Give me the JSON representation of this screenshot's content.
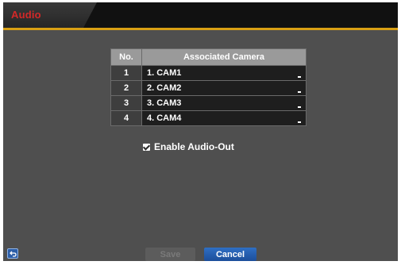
{
  "window": {
    "title": "Audio"
  },
  "table": {
    "headers": {
      "no": "No.",
      "camera": "Associated Camera"
    },
    "rows": [
      {
        "no": "1",
        "camera": "1. CAM1"
      },
      {
        "no": "2",
        "camera": "2. CAM2"
      },
      {
        "no": "3",
        "camera": "3. CAM3"
      },
      {
        "no": "4",
        "camera": "4. CAM4"
      }
    ]
  },
  "options": {
    "enable_audio_out_label": "Enable Audio-Out",
    "enable_audio_out_checked": true
  },
  "buttons": {
    "save": "Save",
    "cancel": "Cancel"
  },
  "icons": {
    "back": "back-arrow-icon",
    "checkbox": "checkbox-icon",
    "dropdown": "dropdown-icon"
  },
  "colors": {
    "title": "#d42828",
    "accent": "#d9a014",
    "primary_button": "#1c4e9a"
  }
}
